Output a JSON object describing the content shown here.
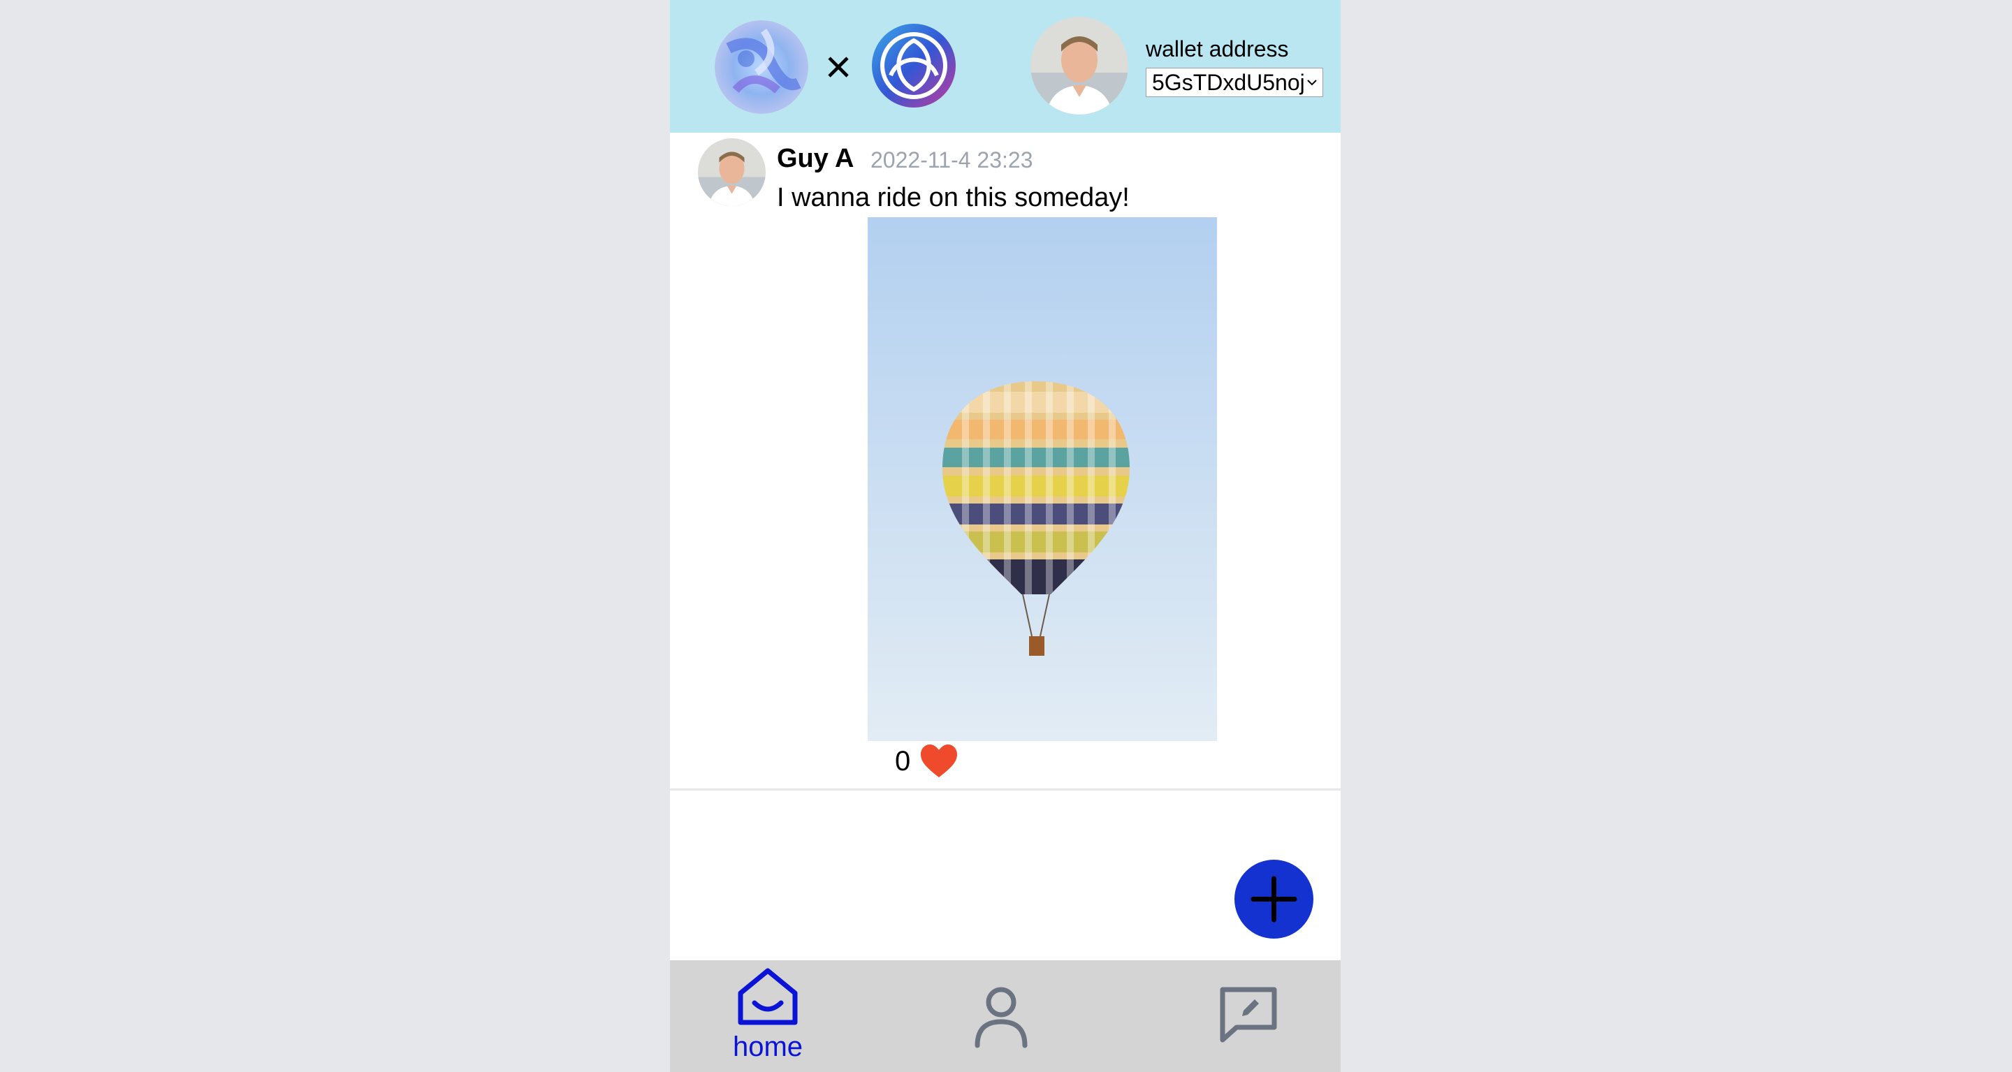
{
  "header": {
    "wallet_label": "wallet address",
    "wallet_selected": "5GsTDxdU5noj",
    "separator": "×",
    "logos": [
      "swirl-logo-icon",
      "triskelion-logo-icon"
    ]
  },
  "post": {
    "author": "Guy A",
    "timestamp": "2022-11-4 23:23",
    "text": "I wanna ride on this someday!",
    "image": "hot-air-balloon-photo",
    "like_count": "0",
    "like_icon": "heart-icon"
  },
  "fab": {
    "icon": "plus-icon"
  },
  "bottom_nav": {
    "home_label": "home",
    "items": [
      "home-icon",
      "profile-icon",
      "message-edit-icon"
    ]
  },
  "colors": {
    "header_bg": "#bae6f2",
    "accent": "#0a13d6",
    "fab": "#1432d0",
    "heart": "#ee4a2b",
    "nav_bg": "#d4d4d4",
    "page_bg": "#e5e7eb"
  }
}
